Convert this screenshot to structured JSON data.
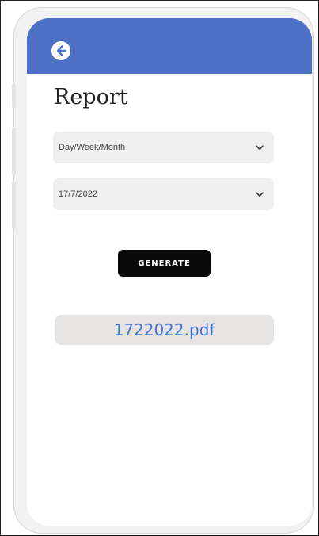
{
  "colors": {
    "header": "#4e71c6",
    "button": "#0a0a0a",
    "link": "#3f73d8",
    "field": "#efefef"
  },
  "header": {
    "back_icon": "arrow-left-circle-icon"
  },
  "page": {
    "title": "Report"
  },
  "form": {
    "period_select": {
      "value": "Day/Week/Month",
      "icon": "chevron-down-icon"
    },
    "date_select": {
      "value": "17/7/2022",
      "icon": "chevron-down-icon"
    },
    "generate_label": "GENERATE"
  },
  "result": {
    "file_name": "1722022.pdf"
  }
}
